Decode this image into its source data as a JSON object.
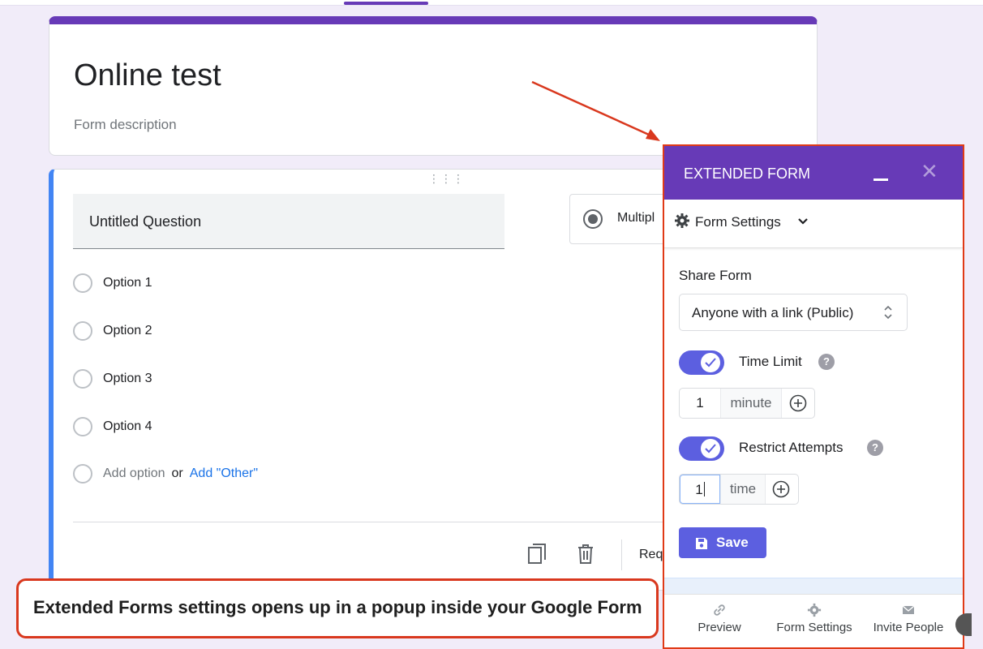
{
  "form": {
    "title": "Online test",
    "description": "Form description"
  },
  "question": {
    "title": "Untitled Question",
    "type_label": "Multipl",
    "options": [
      "Option 1",
      "Option 2",
      "Option 3",
      "Option 4"
    ],
    "add_option": "Add option",
    "or": "or",
    "add_other": "Add \"Other\"",
    "required_label": "Req"
  },
  "panel": {
    "title": "EXTENDED FORM",
    "close": "✕",
    "section_label": "Form Settings",
    "share_label": "Share Form",
    "share_value": "Anyone with a link (Public)",
    "time_limit": {
      "label": "Time Limit",
      "enabled": true,
      "value": "1",
      "unit": "minute"
    },
    "restrict_attempts": {
      "label": "Restrict Attempts",
      "enabled": true,
      "value": "1",
      "unit": "time"
    },
    "help": "?",
    "save_label": "Save",
    "footer": {
      "preview": "Preview",
      "form_settings": "Form Settings",
      "invite": "Invite People"
    }
  },
  "callout": "Extended Forms settings opens up in a popup inside your Google Form",
  "colors": {
    "brand_purple": "#673ab7",
    "accent_indigo": "#5c5fe0",
    "callout_red": "#d9381e",
    "question_blue": "#4285f4"
  }
}
